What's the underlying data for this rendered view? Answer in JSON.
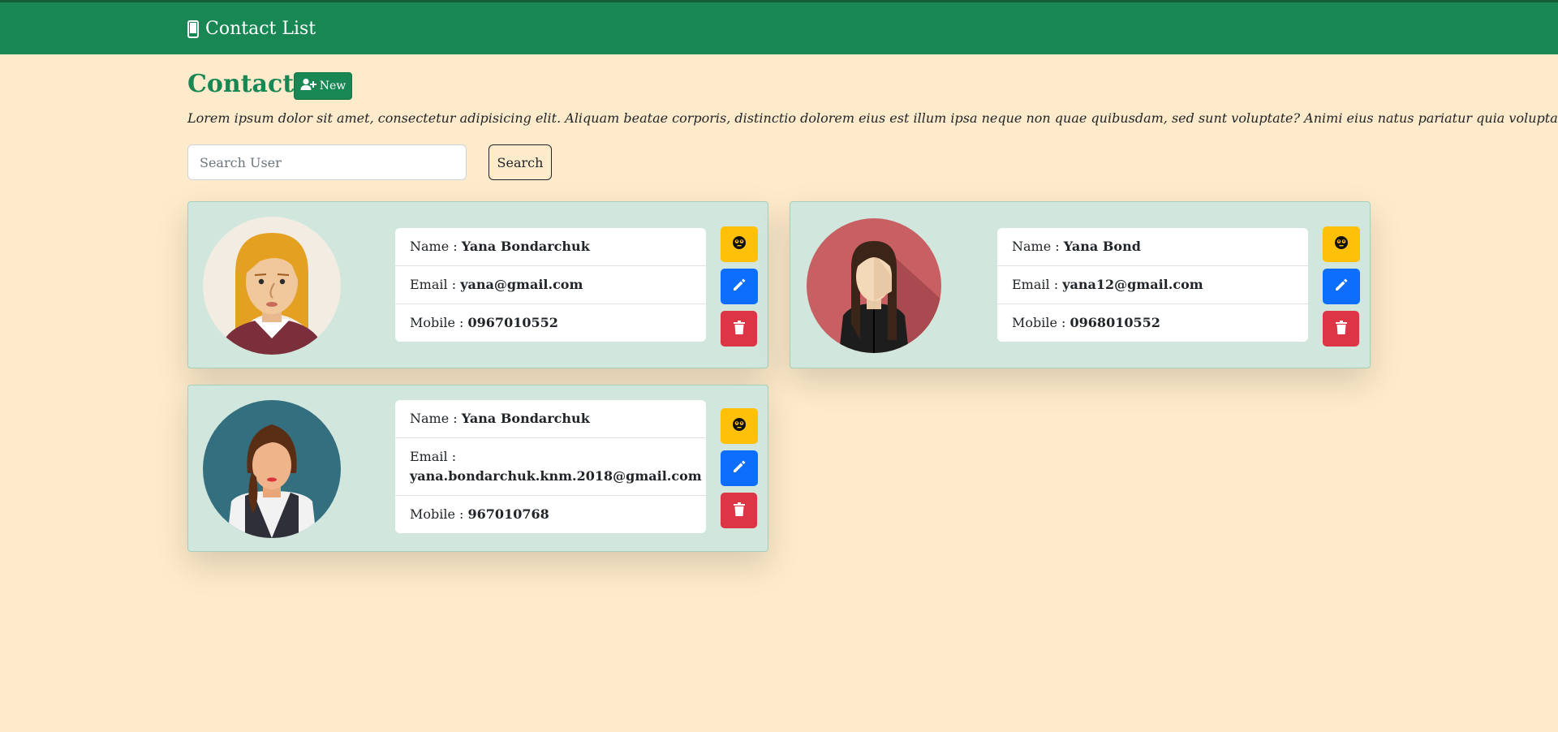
{
  "navbar": {
    "brand": "Contact List",
    "brand_icon": "mobile-phone-icon"
  },
  "header": {
    "title": "Contacts",
    "new_button_label": "New",
    "new_button_icon": "user-plus-icon",
    "description": "Lorem ipsum dolor sit amet, consectetur adipisicing elit. Aliquam beatae corporis, distinctio dolorem eius est illum ipsa neque non quae quibusdam, sed sunt voluptate? Animi eius natus pariatur quia voluptas."
  },
  "search": {
    "placeholder": "Search User",
    "value": "",
    "button_label": "Search"
  },
  "labels": {
    "name": "Name : ",
    "email": "Email : ",
    "mobile": "Mobile : "
  },
  "contacts": [
    {
      "name": "Yana Bondarchuk",
      "email": "yana@gmail.com",
      "mobile": "0967010552",
      "avatar": "blonde-woman-avatar"
    },
    {
      "name": "Yana Bond",
      "email": "yana12@gmail.com",
      "mobile": "0968010552",
      "avatar": "brunette-woman-red-bg-avatar"
    },
    {
      "name": "Yana Bondarchuk",
      "email": "yana.bondarchuk.knm.2018@gmail.com",
      "mobile": "967010768",
      "avatar": "brunette-woman-teal-bg-avatar"
    }
  ],
  "actions": {
    "view_icon": "eye-face-icon",
    "edit_icon": "pencil-icon",
    "delete_icon": "trash-icon"
  },
  "colors": {
    "primary": "#198754",
    "background": "#feebcb",
    "card": "#d1e7dd",
    "warning": "#ffc107",
    "edit": "#0d6efd",
    "danger": "#dc3545"
  }
}
